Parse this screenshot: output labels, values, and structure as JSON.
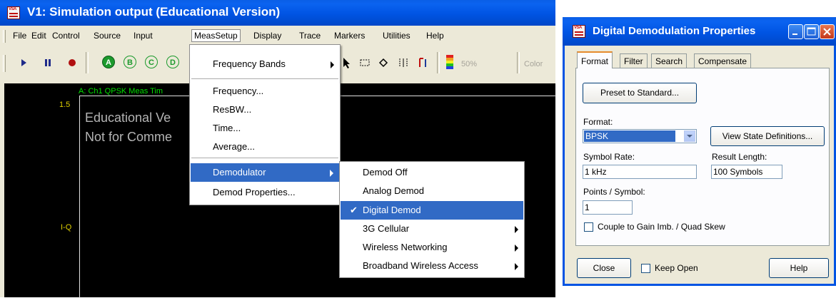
{
  "main_window": {
    "title": "V1: Simulation output (Educational Version)",
    "icon": "vsa-app-icon"
  },
  "menubar": {
    "items": [
      "File",
      "Edit",
      "Control",
      "Source",
      "Input",
      "MeasSetup",
      "Display",
      "Trace",
      "Markers",
      "Utilities",
      "Help"
    ]
  },
  "toolbar": {
    "play_icon": "play-icon",
    "pause_icon": "pause-icon",
    "record_icon": "record-icon",
    "trace_buttons": [
      "A",
      "B",
      "C",
      "D"
    ],
    "zoom_value": "50%",
    "color_label": "Color"
  },
  "display": {
    "trace_label": "A: Ch1 QPSK Meas Tim",
    "y_top": "1.5",
    "y_mid": "I-Q",
    "watermark_line1": "Educational Ve",
    "watermark_line2": "Not for Comme"
  },
  "meassetup_menu": {
    "items": [
      "Frequency Bands",
      "Frequency...",
      "ResBW...",
      "Time...",
      "Average...",
      "Demodulator",
      "Demod Properties..."
    ]
  },
  "demodulator_submenu": {
    "items": [
      "Demod Off",
      "Analog Demod",
      "Digital Demod",
      "3G Cellular",
      "Wireless Networking",
      "Broadband Wireless Access"
    ],
    "checked": "Digital Demod"
  },
  "dialog": {
    "title": "Digital Demodulation Properties",
    "tabs": [
      "Format",
      "Filter",
      "Search",
      "Compensate"
    ],
    "active_tab": "Format",
    "preset_button": "Preset to Standard...",
    "format_label": "Format:",
    "format_value": "BPSK",
    "view_state_button": "View State Definitions...",
    "symbol_rate_label": "Symbol Rate:",
    "symbol_rate_value": "1 kHz",
    "result_length_label": "Result Length:",
    "result_length_value": "100 Symbols",
    "points_label": "Points / Symbol:",
    "points_value": "1",
    "couple_label": "Couple to Gain Imb. / Quad Skew",
    "close_button": "Close",
    "keep_open_label": "Keep Open",
    "help_button": "Help"
  }
}
